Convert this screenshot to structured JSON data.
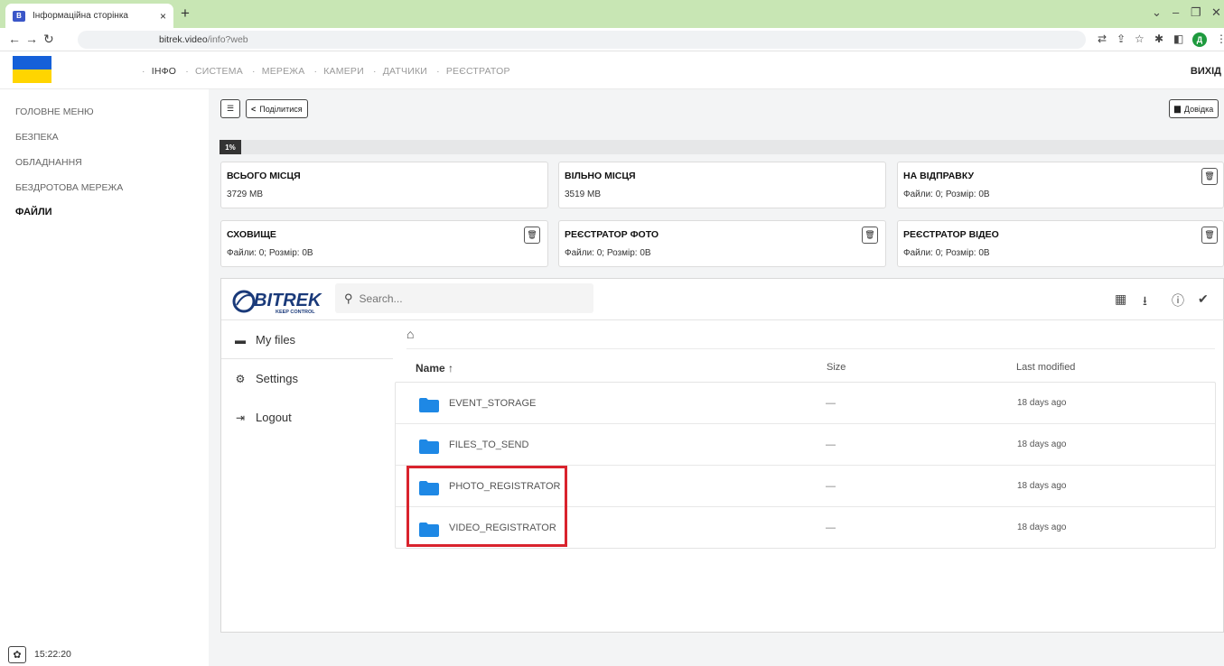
{
  "browser": {
    "tab_title": "Інформаційна сторінка",
    "tab_close": "×",
    "new_tab": "+",
    "url_host": "bitrek.video",
    "url_path": "/info?web",
    "profile_initial": "Д"
  },
  "header": {
    "nav": [
      {
        "label": "ІНФО",
        "active": true
      },
      {
        "label": "СИСТЕМА",
        "active": false
      },
      {
        "label": "МЕРЕЖА",
        "active": false
      },
      {
        "label": "КАМЕРИ",
        "active": false
      },
      {
        "label": "ДАТЧИКИ",
        "active": false
      },
      {
        "label": "РЕЄСТРАТОР",
        "active": false
      }
    ],
    "nav_separator": "·",
    "logout": "ВИХІД"
  },
  "sidebar": {
    "items": [
      {
        "label": "ГОЛОВНЕ МЕНЮ"
      },
      {
        "label": "БЕЗПЕКА"
      },
      {
        "label": "ОБЛАДНАННЯ"
      },
      {
        "label": "БЕЗДРОТОВА МЕРЕЖА"
      },
      {
        "label": "ФАЙЛИ",
        "active": true
      }
    ],
    "clock": "15:22:20"
  },
  "toolbar": {
    "share_label": "Поділитися",
    "help_label": "Довідка"
  },
  "progress": {
    "label": "1%",
    "fraction": 0.01
  },
  "cards": [
    {
      "title": "ВСЬОГО МІСЦЯ",
      "value": "3729 MB"
    },
    {
      "title": "ВІЛЬНО МІСЦЯ",
      "value": "3519 MB"
    },
    {
      "title": "НА ВІДПРАВКУ",
      "value": "Файли: 0; Розмір: 0B"
    },
    {
      "title": "СХОВИЩЕ",
      "value": "Файли: 0; Розмір: 0B"
    },
    {
      "title": "РЕЄСТРАТОР ФОТО",
      "value": "Файли: 0; Розмір: 0B"
    },
    {
      "title": "РЕЄСТРАТОР ВІДЕО",
      "value": "Файли: 0; Розмір: 0B"
    }
  ],
  "filebrowser": {
    "logo_text": "BITREK",
    "logo_sub": "KEEP CONTROL",
    "search_placeholder": "Search...",
    "side": [
      {
        "label": "My files"
      },
      {
        "label": "Settings"
      },
      {
        "label": "Logout"
      }
    ],
    "columns": {
      "name": "Name ↑",
      "size": "Size",
      "modified": "Last modified"
    },
    "rows": [
      {
        "name": "EVENT_STORAGE",
        "size": "—",
        "modified": "18 days ago"
      },
      {
        "name": "FILES_TO_SEND",
        "size": "—",
        "modified": "18 days ago"
      },
      {
        "name": "PHOTO_REGISTRATOR",
        "size": "—",
        "modified": "18 days ago"
      },
      {
        "name": "VIDEO_REGISTRATOR",
        "size": "—",
        "modified": "18 days ago"
      }
    ]
  },
  "colors": {
    "folder": "#1e88e5",
    "highlight": "#d9232d",
    "flag_blue": "#1560d9",
    "flag_yellow": "#ffd500"
  }
}
